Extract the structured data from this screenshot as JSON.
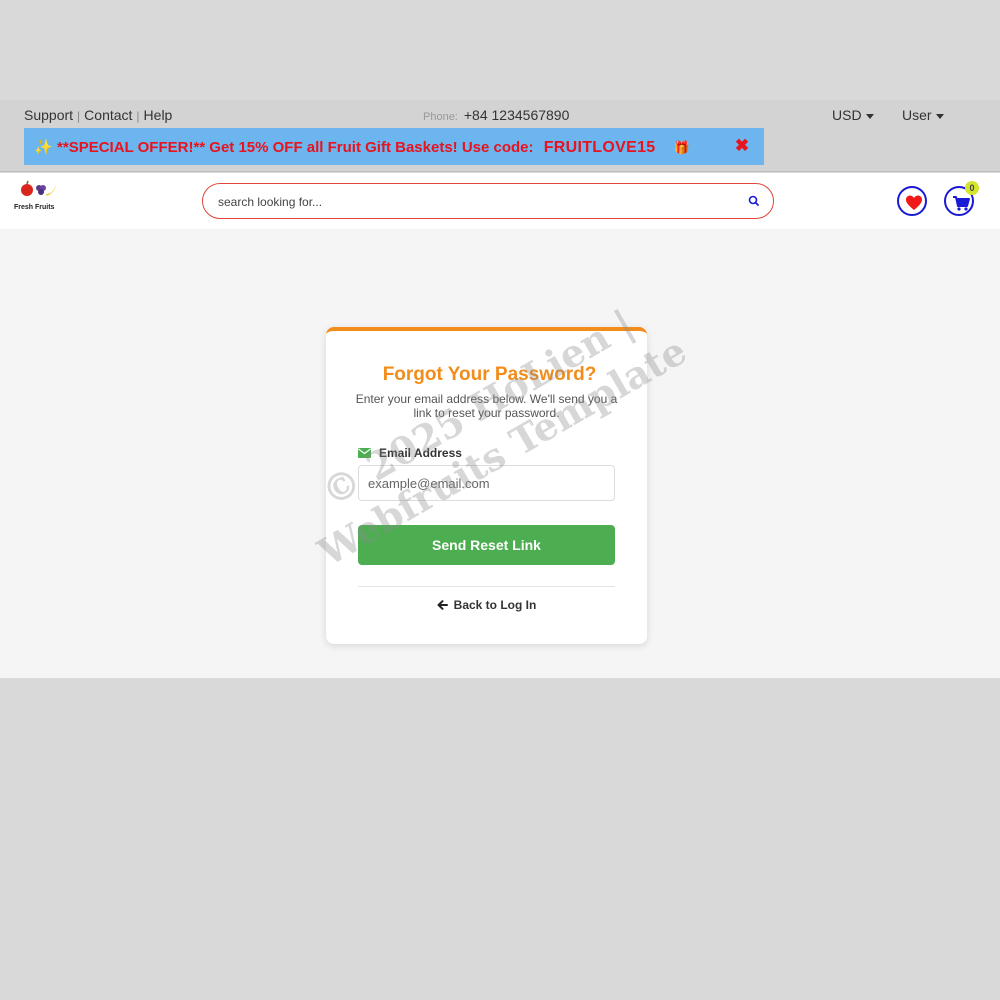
{
  "topbar": {
    "links": [
      {
        "label": "Support"
      },
      {
        "label": "Contact"
      },
      {
        "label": "Help"
      }
    ],
    "separator": "|",
    "phone_label": "Phone:",
    "phone_value": "+84 1234567890",
    "currency": "USD",
    "user": "User"
  },
  "promo": {
    "sparkle": "✨",
    "text": "**SPECIAL OFFER!** Get 15% OFF all Fruit Gift Baskets! Use code:",
    "code": "FRUITLOVE15",
    "gift": "🎁",
    "close": "✖"
  },
  "header": {
    "logo_text": "Fresh Fruits",
    "search_placeholder": "search looking for...",
    "cart_count": "0"
  },
  "card": {
    "title": "Forgot Your Password?",
    "description": "Enter your email address below. We'll send you a link to reset your password.",
    "email_label": "Email Address",
    "email_placeholder": "example@email.com",
    "submit_label": "Send Reset Link",
    "back_label": "Back to Log In"
  },
  "watermark": {
    "line1": "© 2025 HoLien |",
    "line2": "Webfruits Template"
  },
  "colors": {
    "accent_orange": "#f28c1a",
    "primary_green": "#4cae50",
    "promo_red": "#e8131e",
    "promo_bg": "#6cb5ee",
    "icon_blue": "#1a1ad6"
  }
}
